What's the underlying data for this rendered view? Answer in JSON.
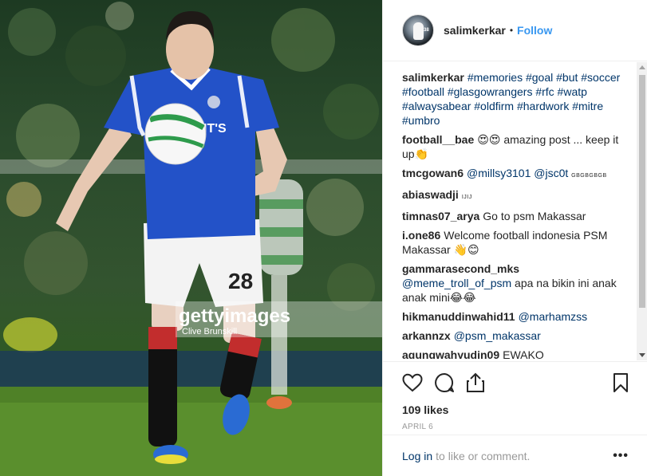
{
  "photo": {
    "watermark_brand": "gettyimages",
    "watermark_credit": "Clive Brunskill",
    "jersey_text": "IT'S",
    "shorts_number": "28"
  },
  "header": {
    "username": "salimkerkar",
    "separator": "•",
    "follow_label": "Follow"
  },
  "caption": {
    "username": "salimkerkar",
    "hashtags": "#memories #goal #but #soccer #football #glasgowrangers #rfc #watp #alwaysabear #oldfirm #hardwork #mitre #umbro"
  },
  "comments": [
    {
      "user": "football__bae",
      "text": "😍😍 amazing post ... keep it up👏"
    },
    {
      "user": "tmcgowan6",
      "mention": "@millsy3101 @jsc0t",
      "text": "gbgbgbgb"
    },
    {
      "user": "abiaswadji",
      "text": "ijij"
    },
    {
      "user": "timnas07_arya",
      "text": "Go to psm Makassar"
    },
    {
      "user": "i.one86",
      "text": "Welcome football indonesia PSM Makassar 👋😊"
    },
    {
      "user": "gammarasecond_mks",
      "mention": "@meme_troll_of_psm",
      "text": "apa na bikin ini anak anak mini😂😂"
    },
    {
      "user": "hikmanuddinwahid11",
      "mention": "@marhamzss",
      "text": ""
    },
    {
      "user": "arkannzx",
      "mention": "@psm_makassar",
      "text": ""
    },
    {
      "user": "agungwahyudin09",
      "text": "EWAKO"
    }
  ],
  "actions": {
    "likes": "109 likes",
    "date": "APRIL 6"
  },
  "footer": {
    "login_link": "Log in",
    "login_rest": "to like or comment.",
    "more": "•••"
  },
  "colors": {
    "link_blue": "#3897f0",
    "mention_blue": "#003569",
    "muted_gray": "#999999",
    "jersey_blue": "#2352c8"
  },
  "icons": {
    "like": "heart-outline-icon",
    "comment": "speech-bubble-icon",
    "share": "share-upload-icon",
    "save": "bookmark-icon"
  }
}
